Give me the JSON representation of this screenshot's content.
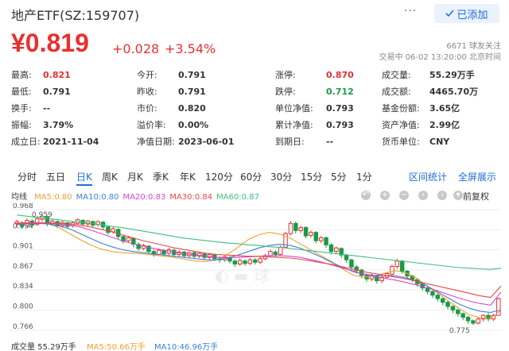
{
  "header": {
    "title": "地产ETF(SZ:159707)",
    "more_label": "···",
    "follow_label": "已添加",
    "follow_icon": "check-icon"
  },
  "quote": {
    "price": "¥0.819",
    "change": "+0.028",
    "change_pct": "+3.54%",
    "followers": "6671 球友关注",
    "trade_status": "交易中 06-02 13:20:00 北京时间",
    "up_color": "#e93030",
    "down_color": "#1a9a46"
  },
  "stats": [
    [
      {
        "label": "最高:",
        "value": "0.821",
        "tone": "up"
      },
      {
        "label": "今开:",
        "value": "0.791",
        "tone": "normal"
      },
      {
        "label": "涨停:",
        "value": "0.870",
        "tone": "up"
      },
      {
        "label": "成交量:",
        "value": "55.29万手",
        "tone": "normal"
      }
    ],
    [
      {
        "label": "最低:",
        "value": "0.791",
        "tone": "normal"
      },
      {
        "label": "昨收:",
        "value": "0.791",
        "tone": "normal"
      },
      {
        "label": "跌停:",
        "value": "0.712",
        "tone": "down"
      },
      {
        "label": "成交额:",
        "value": "4465.70万",
        "tone": "normal"
      }
    ],
    [
      {
        "label": "换手:",
        "value": "--",
        "tone": "normal"
      },
      {
        "label": "市价:",
        "value": "0.820",
        "tone": "normal"
      },
      {
        "label": "单位净值:",
        "value": "0.793",
        "tone": "normal"
      },
      {
        "label": "基金份额:",
        "value": "3.65亿",
        "tone": "normal"
      }
    ],
    [
      {
        "label": "振幅:",
        "value": "3.79%",
        "tone": "normal"
      },
      {
        "label": "溢价率:",
        "value": "0.00%",
        "tone": "normal"
      },
      {
        "label": "累计净值:",
        "value": "0.793",
        "tone": "normal"
      },
      {
        "label": "资产净值:",
        "value": "2.99亿",
        "tone": "normal"
      }
    ],
    [
      {
        "label": "成立日:",
        "value": "2021-11-04",
        "tone": "normal"
      },
      {
        "label": "净值日期:",
        "value": "2023-06-01",
        "tone": "normal"
      },
      {
        "label": "到期日:",
        "value": "--",
        "tone": "normal"
      },
      {
        "label": "货币单位:",
        "value": "CNY",
        "tone": "normal"
      }
    ]
  ],
  "tabs": [
    "分时",
    "五日",
    "日K",
    "周K",
    "月K",
    "季K",
    "年K",
    "120分",
    "60分",
    "30分",
    "15分",
    "5分",
    "1分"
  ],
  "active_tab": "日K",
  "tab_actions": [
    "区间统计",
    "全屏展示"
  ],
  "ma_legend": {
    "label": "均线",
    "items": [
      {
        "text": "MA5:0.80",
        "color": "#f0a22e"
      },
      {
        "text": "MA10:0.80",
        "color": "#3d7fd8"
      },
      {
        "text": "MA20:0.83",
        "color": "#d447c8"
      },
      {
        "text": "MA30:0.84",
        "color": "#e84848"
      },
      {
        "text": "MA60:0.87",
        "color": "#3fbf7f"
      }
    ]
  },
  "chart_tools": [
    "undo-icon",
    "zoom-in-icon",
    "zoom-out-icon",
    "move-left-icon",
    "move-right-icon"
  ],
  "fq_label": "前复权",
  "chart_data": {
    "type": "candlestick",
    "y_ticks": [
      "0.968",
      "0.934",
      "0.901",
      "0.867",
      "0.834",
      "0.800",
      "0.766"
    ],
    "ylim": [
      0.766,
      0.968
    ],
    "annotations": {
      "max_label": "0.959",
      "min_label": "0.775"
    },
    "candles": [
      [
        0.945,
        0.948,
        0.951,
        0.938
      ],
      [
        0.946,
        0.94,
        0.949,
        0.936
      ],
      [
        0.941,
        0.95,
        0.953,
        0.939
      ],
      [
        0.949,
        0.942,
        0.952,
        0.937
      ],
      [
        0.943,
        0.953,
        0.956,
        0.941
      ],
      [
        0.952,
        0.957,
        0.959,
        0.948
      ],
      [
        0.956,
        0.944,
        0.958,
        0.94
      ],
      [
        0.945,
        0.949,
        0.952,
        0.942
      ],
      [
        0.948,
        0.941,
        0.95,
        0.937
      ],
      [
        0.941,
        0.947,
        0.949,
        0.938
      ],
      [
        0.946,
        0.94,
        0.948,
        0.936
      ],
      [
        0.941,
        0.946,
        0.948,
        0.938
      ],
      [
        0.945,
        0.951,
        0.953,
        0.943
      ],
      [
        0.95,
        0.944,
        0.952,
        0.941
      ],
      [
        0.944,
        0.949,
        0.951,
        0.941
      ],
      [
        0.948,
        0.942,
        0.95,
        0.939
      ],
      [
        0.943,
        0.948,
        0.95,
        0.94
      ],
      [
        0.947,
        0.939,
        0.949,
        0.935
      ],
      [
        0.939,
        0.93,
        0.941,
        0.926
      ],
      [
        0.931,
        0.936,
        0.939,
        0.928
      ],
      [
        0.935,
        0.923,
        0.937,
        0.919
      ],
      [
        0.923,
        0.915,
        0.926,
        0.911
      ],
      [
        0.916,
        0.921,
        0.924,
        0.913
      ],
      [
        0.92,
        0.91,
        0.922,
        0.905
      ],
      [
        0.91,
        0.903,
        0.913,
        0.899
      ],
      [
        0.903,
        0.908,
        0.911,
        0.9
      ],
      [
        0.907,
        0.898,
        0.909,
        0.894
      ],
      [
        0.898,
        0.893,
        0.901,
        0.889
      ],
      [
        0.893,
        0.9,
        0.903,
        0.89
      ],
      [
        0.899,
        0.894,
        0.902,
        0.89
      ],
      [
        0.895,
        0.901,
        0.904,
        0.892
      ],
      [
        0.9,
        0.893,
        0.903,
        0.889
      ],
      [
        0.893,
        0.897,
        0.9,
        0.89
      ],
      [
        0.897,
        0.891,
        0.899,
        0.887
      ],
      [
        0.891,
        0.896,
        0.898,
        0.888
      ],
      [
        0.896,
        0.89,
        0.898,
        0.886
      ],
      [
        0.89,
        0.895,
        0.897,
        0.887
      ],
      [
        0.894,
        0.888,
        0.896,
        0.884
      ],
      [
        0.888,
        0.893,
        0.895,
        0.885
      ],
      [
        0.892,
        0.886,
        0.894,
        0.882
      ],
      [
        0.886,
        0.884,
        0.89,
        0.879
      ],
      [
        0.884,
        0.889,
        0.892,
        0.881
      ],
      [
        0.888,
        0.882,
        0.89,
        0.878
      ],
      [
        0.882,
        0.877,
        0.885,
        0.872
      ],
      [
        0.877,
        0.883,
        0.886,
        0.874
      ],
      [
        0.882,
        0.878,
        0.885,
        0.874
      ],
      [
        0.878,
        0.884,
        0.887,
        0.875
      ],
      [
        0.884,
        0.88,
        0.887,
        0.876
      ],
      [
        0.88,
        0.886,
        0.889,
        0.877
      ],
      [
        0.886,
        0.891,
        0.894,
        0.883
      ],
      [
        0.891,
        0.898,
        0.901,
        0.888
      ],
      [
        0.897,
        0.893,
        0.9,
        0.889
      ],
      [
        0.893,
        0.905,
        0.908,
        0.891
      ],
      [
        0.905,
        0.928,
        0.931,
        0.903
      ],
      [
        0.928,
        0.945,
        0.949,
        0.925
      ],
      [
        0.945,
        0.933,
        0.948,
        0.928
      ],
      [
        0.933,
        0.938,
        0.941,
        0.929
      ],
      [
        0.938,
        0.924,
        0.94,
        0.92
      ],
      [
        0.925,
        0.93,
        0.933,
        0.921
      ],
      [
        0.93,
        0.916,
        0.932,
        0.912
      ],
      [
        0.916,
        0.921,
        0.924,
        0.912
      ],
      [
        0.921,
        0.909,
        0.923,
        0.904
      ],
      [
        0.909,
        0.898,
        0.912,
        0.893
      ],
      [
        0.898,
        0.904,
        0.906,
        0.894
      ],
      [
        0.903,
        0.892,
        0.905,
        0.887
      ],
      [
        0.892,
        0.884,
        0.894,
        0.879
      ],
      [
        0.884,
        0.872,
        0.886,
        0.867
      ],
      [
        0.872,
        0.866,
        0.875,
        0.861
      ],
      [
        0.867,
        0.858,
        0.869,
        0.853
      ],
      [
        0.858,
        0.852,
        0.861,
        0.847
      ],
      [
        0.852,
        0.858,
        0.861,
        0.848
      ],
      [
        0.857,
        0.849,
        0.859,
        0.844
      ],
      [
        0.849,
        0.855,
        0.858,
        0.845
      ],
      [
        0.855,
        0.861,
        0.864,
        0.852
      ],
      [
        0.86,
        0.873,
        0.876,
        0.857
      ],
      [
        0.873,
        0.882,
        0.886,
        0.869
      ],
      [
        0.882,
        0.865,
        0.884,
        0.861
      ],
      [
        0.865,
        0.857,
        0.867,
        0.852
      ],
      [
        0.857,
        0.851,
        0.859,
        0.847
      ],
      [
        0.851,
        0.844,
        0.853,
        0.839
      ],
      [
        0.844,
        0.837,
        0.846,
        0.832
      ],
      [
        0.837,
        0.831,
        0.839,
        0.826
      ],
      [
        0.831,
        0.825,
        0.833,
        0.82
      ],
      [
        0.825,
        0.819,
        0.828,
        0.814
      ],
      [
        0.819,
        0.813,
        0.821,
        0.808
      ],
      [
        0.813,
        0.806,
        0.815,
        0.801
      ],
      [
        0.806,
        0.8,
        0.808,
        0.795
      ],
      [
        0.8,
        0.794,
        0.802,
        0.789
      ],
      [
        0.794,
        0.788,
        0.796,
        0.783
      ],
      [
        0.788,
        0.782,
        0.79,
        0.777
      ],
      [
        0.782,
        0.778,
        0.784,
        0.775
      ],
      [
        0.778,
        0.785,
        0.788,
        0.776
      ],
      [
        0.785,
        0.791,
        0.793,
        0.781
      ],
      [
        0.791,
        0.785,
        0.795,
        0.781
      ],
      [
        0.785,
        0.791,
        0.794,
        0.782
      ],
      [
        0.791,
        0.819,
        0.821,
        0.791
      ]
    ],
    "ma": {
      "MA5": [
        0.946,
        0.945,
        0.946,
        0.944,
        0.938,
        0.928,
        0.918,
        0.909,
        0.902,
        0.898,
        0.896,
        0.895,
        0.894,
        0.892,
        0.89,
        0.888,
        0.885,
        0.882,
        0.881,
        0.884,
        0.893,
        0.905,
        0.918,
        0.926,
        0.93,
        0.927,
        0.92,
        0.91,
        0.9,
        0.89,
        0.88,
        0.868,
        0.858,
        0.855,
        0.857,
        0.862,
        0.866,
        0.862,
        0.853,
        0.84,
        0.828,
        0.815,
        0.803,
        0.792,
        0.787,
        0.786,
        0.8
      ],
      "MA10": [
        0.943,
        0.944,
        0.945,
        0.944,
        0.941,
        0.936,
        0.928,
        0.92,
        0.912,
        0.906,
        0.901,
        0.898,
        0.896,
        0.894,
        0.892,
        0.89,
        0.888,
        0.886,
        0.884,
        0.884,
        0.887,
        0.892,
        0.898,
        0.904,
        0.908,
        0.91,
        0.908,
        0.903,
        0.896,
        0.888,
        0.879,
        0.871,
        0.864,
        0.86,
        0.858,
        0.858,
        0.857,
        0.854,
        0.848,
        0.84,
        0.83,
        0.82,
        0.81,
        0.803,
        0.798,
        0.796,
        0.8
      ],
      "MA20": [
        0.944,
        0.945,
        0.945,
        0.945,
        0.944,
        0.942,
        0.939,
        0.934,
        0.928,
        0.922,
        0.916,
        0.911,
        0.907,
        0.903,
        0.9,
        0.897,
        0.894,
        0.892,
        0.89,
        0.888,
        0.888,
        0.888,
        0.889,
        0.89,
        0.891,
        0.891,
        0.89,
        0.888,
        0.884,
        0.88,
        0.875,
        0.87,
        0.865,
        0.86,
        0.856,
        0.853,
        0.85,
        0.846,
        0.842,
        0.837,
        0.832,
        0.826,
        0.82,
        0.815,
        0.811,
        0.808,
        0.83
      ],
      "MA30": [
        0.945,
        0.946,
        0.946,
        0.946,
        0.945,
        0.944,
        0.942,
        0.939,
        0.935,
        0.931,
        0.926,
        0.921,
        0.916,
        0.912,
        0.908,
        0.904,
        0.901,
        0.898,
        0.895,
        0.893,
        0.892,
        0.891,
        0.89,
        0.89,
        0.889,
        0.888,
        0.887,
        0.885,
        0.882,
        0.879,
        0.876,
        0.872,
        0.868,
        0.864,
        0.861,
        0.858,
        0.855,
        0.852,
        0.848,
        0.844,
        0.84,
        0.836,
        0.832,
        0.828,
        0.824,
        0.821,
        0.84
      ],
      "MA60": [
        0.959,
        0.957,
        0.955,
        0.953,
        0.951,
        0.949,
        0.947,
        0.945,
        0.943,
        0.94,
        0.938,
        0.935,
        0.932,
        0.929,
        0.926,
        0.923,
        0.92,
        0.918,
        0.916,
        0.914,
        0.912,
        0.911,
        0.909,
        0.908,
        0.906,
        0.905,
        0.903,
        0.901,
        0.899,
        0.897,
        0.895,
        0.893,
        0.891,
        0.889,
        0.887,
        0.885,
        0.883,
        0.881,
        0.879,
        0.877,
        0.875,
        0.873,
        0.871,
        0.87,
        0.869,
        0.868,
        0.87
      ]
    }
  },
  "volume_row": {
    "label": "成交量 55.29万手",
    "ma5": {
      "text": "MA5:50.66万手",
      "color": "#f0a22e"
    },
    "ma10": {
      "text": "MA10:46.96万手",
      "color": "#3d7fd8"
    }
  }
}
